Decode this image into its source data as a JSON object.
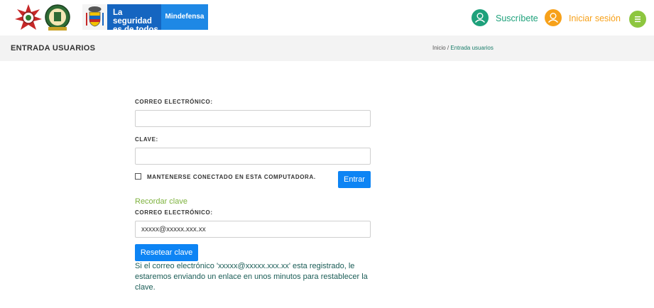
{
  "header": {
    "gov_banner": {
      "line1": "La seguridad",
      "line2": "es de todos"
    },
    "ministry": "Mindefensa",
    "subscribe_label": "Suscríbete",
    "login_label": "Iniciar sesión",
    "icons": [
      "police-emblem-icon",
      "police-shield-icon",
      "colombia-coat-of-arms-icon",
      "user-icon",
      "user-icon",
      "menu-icon"
    ],
    "colors": {
      "subscribe": "#1ea17b",
      "login": "#f7a11a",
      "menu": "#8dc63f",
      "gov_blue": "#1565c0",
      "ministry_blue": "#1e88e5"
    }
  },
  "titlebar": {
    "title": "ENTRADA USUARIOS",
    "breadcrumb": {
      "home": "Inicio",
      "separator": " / ",
      "current": "Entrada usuarios"
    }
  },
  "login_form": {
    "email_label": "CORREO ELECTRÓNICO:",
    "email_value": "",
    "password_label": "CLAVE:",
    "password_value": "",
    "remember_label": "MANTENERSE CONECTADO EN ESTA COMPUTADORA.",
    "remember_checked": false,
    "submit_label": "Entrar"
  },
  "reset_form": {
    "link_label": "Recordar clave",
    "email_label": "CORREO ELECTRÓNICO:",
    "email_value": "xxxxx@xxxxx.xxx.xx",
    "submit_label": "Resetear clave",
    "message": "Si el correo electrónico 'xxxxx@xxxxx.xxx.xx' esta registrado, le estaremos enviando un enlace en unos minutos para restablecer la clave."
  },
  "colors": {
    "primary_button": "#0d84f4",
    "link_green": "#7db23d",
    "message_text": "#1a5c56"
  }
}
